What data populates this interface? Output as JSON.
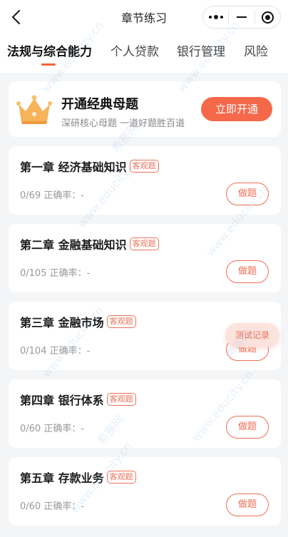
{
  "header": {
    "title": "章节练习"
  },
  "tabs": [
    {
      "label": "法规与综合能力",
      "active": true
    },
    {
      "label": "个人贷款",
      "active": false
    },
    {
      "label": "银行管理",
      "active": false
    },
    {
      "label": "风险",
      "active": false
    }
  ],
  "promo": {
    "title": "开通经典母题",
    "subtitle": "深研核心母题 一道好题胜百道",
    "button": "立即开通"
  },
  "chapters": [
    {
      "title": "第一章 经济基础知识",
      "tag": "客观题",
      "progress": "0/69",
      "accuracy": "正确率：-",
      "button": "做题"
    },
    {
      "title": "第二章 金融基础知识",
      "tag": "客观题",
      "progress": "0/105",
      "accuracy": "正确率：-",
      "button": "做题"
    },
    {
      "title": "第三章 金融市场",
      "tag": "客观题",
      "progress": "0/104",
      "accuracy": "正确率：-",
      "button": "做题"
    },
    {
      "title": "第四章 银行体系",
      "tag": "客观题",
      "progress": "0/60",
      "accuracy": "正确率：-",
      "button": "做题"
    },
    {
      "title": "第五章 存款业务",
      "tag": "客观题",
      "progress": "0/60",
      "accuracy": "正确率：-",
      "button": "做题"
    }
  ],
  "floating": {
    "label": "测试记录"
  },
  "watermark": {
    "text": "www.educity.cn",
    "brand": "希赛网"
  },
  "colors": {
    "accent": "#f5684a",
    "tag": "#e9735a",
    "background": "#f4f5f7"
  }
}
